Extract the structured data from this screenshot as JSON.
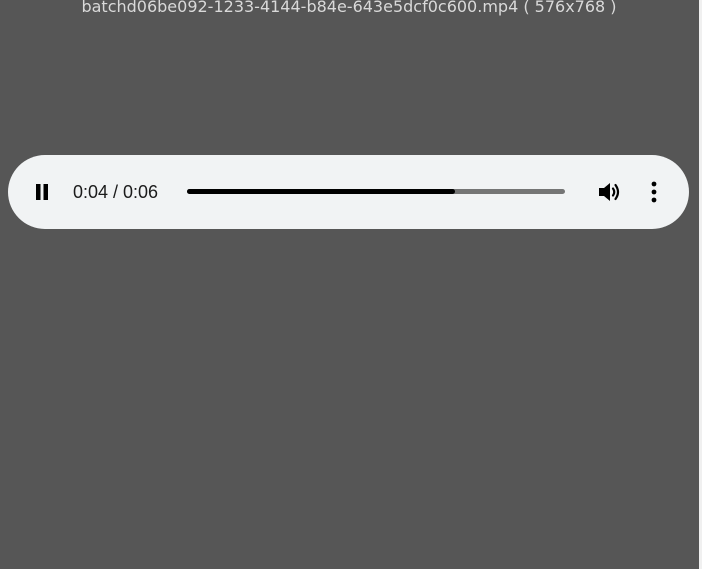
{
  "window": {
    "title": "batchd06be092-1233-4144-b84e-643e5dcf0c600.mp4 ( 576x768 )"
  },
  "player": {
    "current_time": "0:04",
    "duration": "0:06",
    "time_display": "0:04 / 0:06",
    "progress_fraction": 0.71,
    "state": "playing",
    "icons": {
      "play_pause": "pause-icon",
      "volume": "volume-icon",
      "menu": "more-vert-icon"
    },
    "colors": {
      "bar_background": "#f1f3f4",
      "progress_played": "#000000",
      "progress_remaining": "#757575",
      "page_background": "#565656"
    }
  }
}
